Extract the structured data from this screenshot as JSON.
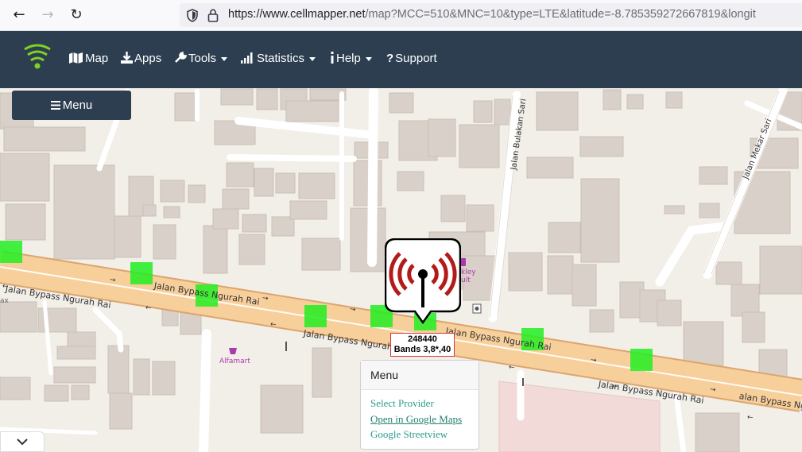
{
  "browser": {
    "url_host": "https://www.cellmapper.net",
    "url_path": "/map?MCC=510&MNC=10&type=LTE&latitude=-8.785359272667819&longit",
    "icons": [
      "back-icon",
      "forward-icon",
      "reload-icon",
      "shield-icon",
      "lock-icon"
    ]
  },
  "nav": {
    "items": [
      {
        "label": "Map",
        "icon": "map-icon"
      },
      {
        "label": "Apps",
        "icon": "download-icon"
      },
      {
        "label": "Tools",
        "icon": "wrench-icon"
      },
      {
        "label": "Statistics",
        "icon": "signal-icon"
      },
      {
        "label": "Help",
        "icon": "info-icon"
      },
      {
        "label": "Support",
        "icon": "question-icon"
      }
    ]
  },
  "map": {
    "menu_label": "Menu",
    "streets": {
      "main_west": "Jalan Bypass Ngurah Rai",
      "main_mid": "Jalan Bypass Ngurah Rai",
      "main_south": "Jalan Bypass Ngurah Rai",
      "main_east": "Jalan Bypass Ngurah Rai",
      "main_far_east": "alan Bypass Ngu",
      "north_1": "Jalan Bulakan Sari",
      "north_2": "Jalan Mekar Sari"
    },
    "poi": {
      "alfamart": "Alfamart",
      "partial_1": "kley",
      "partial_2": "ult",
      "partial_3": "ax"
    },
    "cell": {
      "id": "248440",
      "bands": "Bands 3,8*,40"
    },
    "popup": {
      "title": "Menu",
      "links": [
        "Select Provider",
        "Open in Google Maps",
        "Google Streetview"
      ]
    }
  },
  "colors": {
    "nav_bg": "#2c3e50",
    "tile_green": "#22ee22",
    "road": "#f7cf9b",
    "link": "#2a9d8f",
    "tower_red": "#b31b1b"
  }
}
